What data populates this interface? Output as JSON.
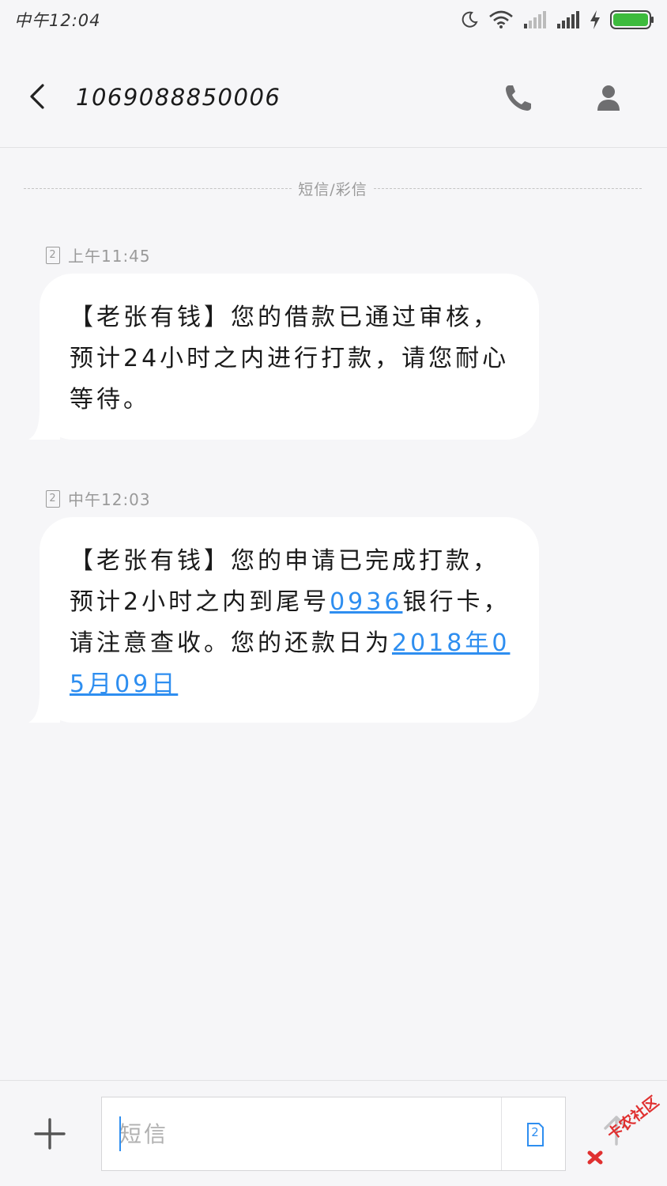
{
  "status_bar": {
    "time": "中午12:04",
    "icons": [
      "moon-icon",
      "wifi-icon",
      "signal-icon",
      "signal-icon",
      "charging-icon",
      "battery-icon"
    ],
    "battery_color": "#3dbb3d"
  },
  "header": {
    "title": "1069088850006",
    "back_icon": "chevron-left-icon",
    "call_icon": "phone-icon",
    "contact_icon": "person-icon"
  },
  "thread": {
    "divider_label": "短信/彩信",
    "messages": [
      {
        "sim": "2",
        "time": "上午11:45",
        "text": "【老张有钱】您的借款已通过审核，预计24小时之内进行打款，请您耐心等待。"
      },
      {
        "sim": "2",
        "time": "中午12:03",
        "text_part1": "【老张有钱】您的申请已完成打款，预计2小时之内到尾号",
        "link_card": "0936",
        "text_part2": "银行卡，请注意查收。您的还款日为",
        "link_date": "2018年05月09日"
      }
    ]
  },
  "composer": {
    "placeholder": "短信",
    "sim": "2",
    "add_icon": "plus-icon",
    "send_icon": "send-arrow-icon"
  },
  "watermark": {
    "text": "卡农社区"
  },
  "colors": {
    "background": "#f6f6f8",
    "bubble": "#ffffff",
    "link": "#2e8ef0",
    "muted": "#9a9a9a"
  }
}
